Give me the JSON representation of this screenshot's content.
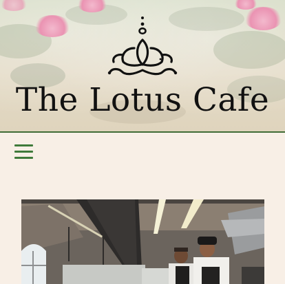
{
  "header": {
    "title": "The Lotus Cafe",
    "logo_icon": "lotus-logo-icon",
    "divider_color": "#3f6b35"
  },
  "nav": {
    "menu_icon": "hamburger-menu-icon",
    "menu_color": "#3f7a3a"
  },
  "main": {
    "photo_icon": "kitchen-chefs-photo"
  },
  "colors": {
    "background": "#f8efe6",
    "accent": "#3f6b35"
  }
}
